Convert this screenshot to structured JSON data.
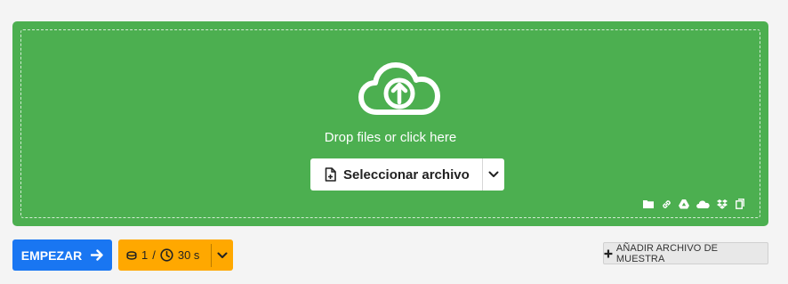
{
  "dropzone": {
    "prompt": "Drop files or click here",
    "select_label": "Seleccionar archivo",
    "sources": [
      "folder-icon",
      "link-icon",
      "google-drive-icon",
      "onedrive-icon",
      "dropbox-icon",
      "clipboard-icon"
    ],
    "color": "#4caf50"
  },
  "actions": {
    "start_label": "EMPEZAR",
    "credits": "1",
    "separator": "/",
    "time": "30 s",
    "sample_label": "AÑADIR ARCHIVO DE MUESTRA"
  },
  "colors": {
    "start": "#1976f2",
    "options": "#ffa800"
  }
}
